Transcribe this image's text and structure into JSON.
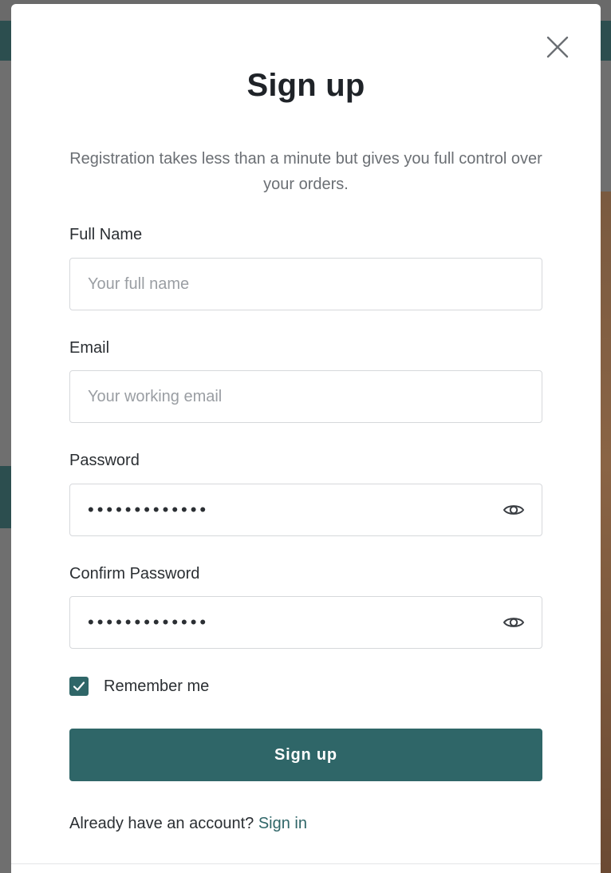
{
  "modal": {
    "title": "Sign up",
    "subtitle": "Registration takes less than a minute but gives you full control over your orders."
  },
  "form": {
    "full_name": {
      "label": "Full Name",
      "placeholder": "Your full name",
      "value": ""
    },
    "email": {
      "label": "Email",
      "placeholder": "Your working email",
      "value": ""
    },
    "password": {
      "label": "Password",
      "value": "•••••••••••••"
    },
    "confirm_password": {
      "label": "Confirm Password",
      "value": "•••••••••••••"
    },
    "remember_me": {
      "label": "Remember me",
      "checked": true
    },
    "submit_label": "Sign up"
  },
  "footer": {
    "prompt": "Already have an account?",
    "link_label": "Sign in"
  },
  "icons": {
    "close": "close-icon",
    "eye": "eye-icon",
    "check": "checkmark-icon"
  },
  "colors": {
    "accent": "#2f6668",
    "title_text": "#1f2328",
    "muted_text": "#6b6f74"
  }
}
